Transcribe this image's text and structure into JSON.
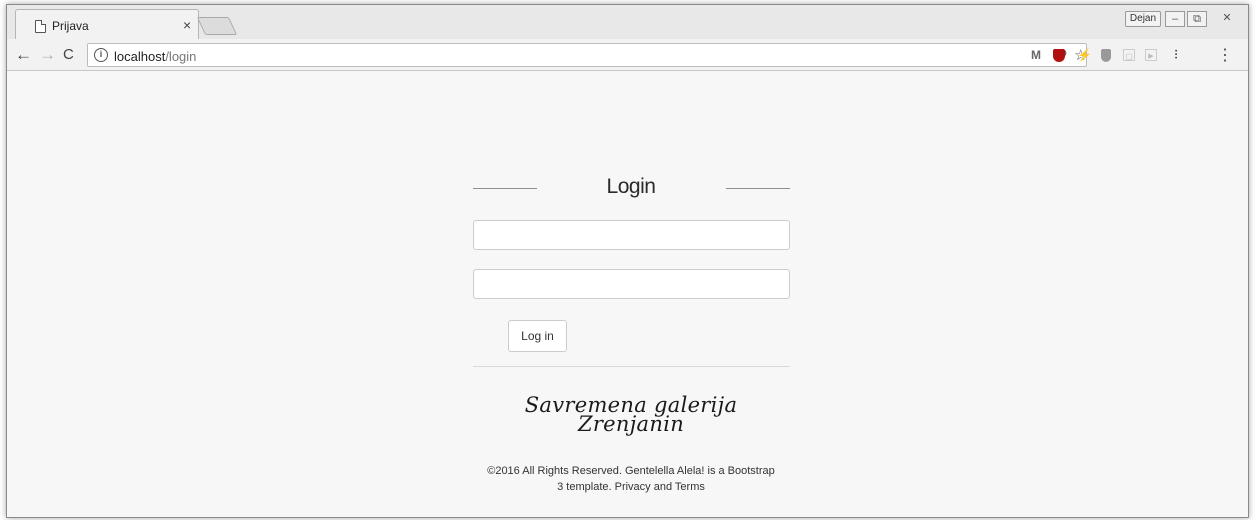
{
  "browser": {
    "tab_title": "Prijava",
    "tab_close": "×",
    "profile_name": "Dejan",
    "url_host": "localhost",
    "url_path": "/login",
    "controls": {
      "minimize": "–",
      "maximize": "⧉",
      "close": "✕"
    }
  },
  "login": {
    "title": "Login",
    "username_value": "",
    "password_value": "",
    "button_label": "Log in"
  },
  "brand": {
    "line1": "Savremena galerija",
    "line2": "Zrenjanin"
  },
  "footer": {
    "line1": "©2016 All Rights Reserved. Gentelella Alela! is a Bootstrap",
    "line2": "3 template. Privacy and Terms"
  }
}
